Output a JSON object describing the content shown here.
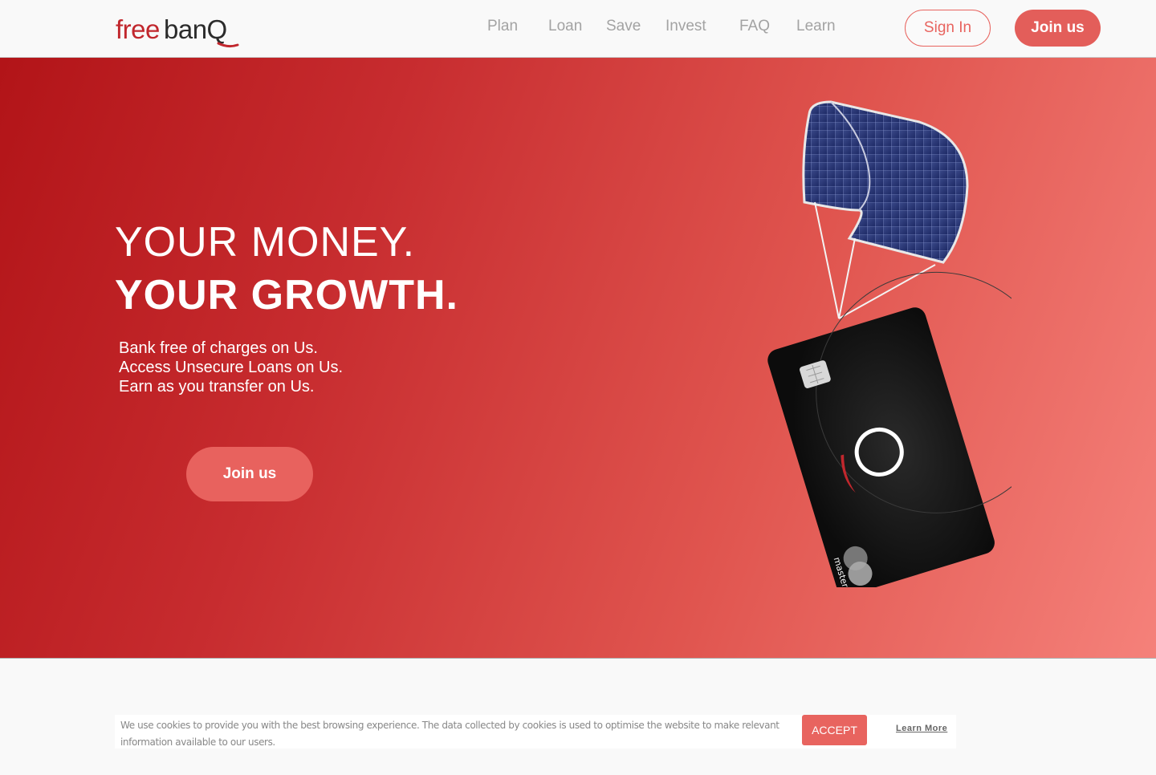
{
  "header": {
    "logo_free": "free",
    "logo_ban": "banQ",
    "nav": [
      {
        "label": "Plan"
      },
      {
        "label": "Loan"
      },
      {
        "label": "Save"
      },
      {
        "label": "Invest"
      },
      {
        "label": "FAQ"
      },
      {
        "label": "Learn"
      }
    ],
    "signin_label": "Sign In",
    "join_label": "Join us"
  },
  "hero": {
    "headline_line1": "YOUR MONEY.",
    "headline_line2": "YOUR GROWTH.",
    "subtext": [
      "Bank free of charges on Us.",
      "Access Unsecure Loans on Us.",
      "Earn as you transfer on Us."
    ],
    "join_label": "Join us",
    "card_brand": "mastercard"
  },
  "cookie": {
    "text": "We use cookies to provide you with the best browsing experience. The data collected by cookies is used to optimise the website to make relevant information available to our users.",
    "accept_label": "ACCEPT",
    "learn_more_label": "Learn More"
  },
  "colors": {
    "brand_red": "#c1272d",
    "accent": "#e35e5a",
    "hero_gradient_start": "#b21418",
    "hero_gradient_end": "#f5817a"
  }
}
